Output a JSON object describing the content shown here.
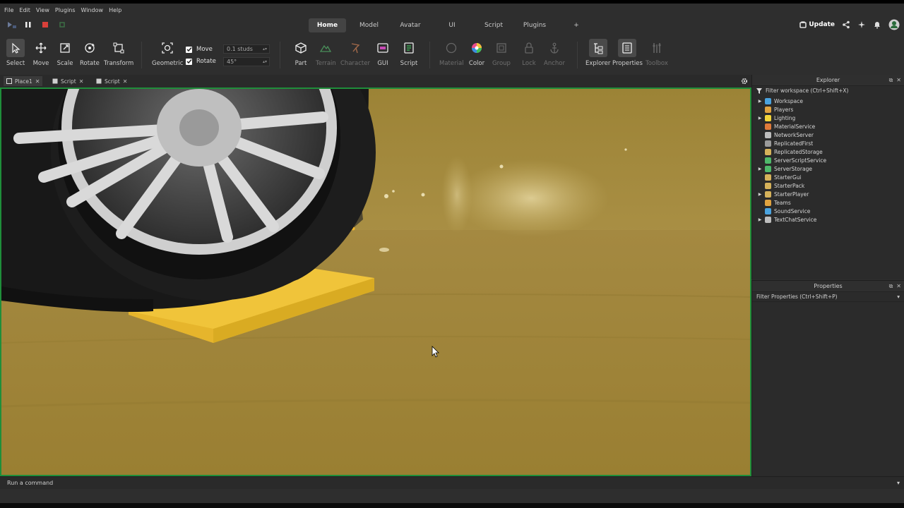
{
  "menu": [
    "File",
    "Edit",
    "View",
    "Plugins",
    "Window",
    "Help"
  ],
  "ribbon_tabs": [
    {
      "label": "Home",
      "active": true
    },
    {
      "label": "Model",
      "active": false
    },
    {
      "label": "Avatar",
      "active": false
    },
    {
      "label": "UI",
      "active": false
    },
    {
      "label": "Script",
      "active": false
    },
    {
      "label": "Plugins",
      "active": false
    },
    {
      "label": "+",
      "active": false
    }
  ],
  "header_right": {
    "update_label": "Update"
  },
  "tools": {
    "select": "Select",
    "move": "Move",
    "scale": "Scale",
    "rotate": "Rotate",
    "transform": "Transform",
    "geometric": "Geometric",
    "part": "Part",
    "terrain": "Terrain",
    "character": "Character",
    "gui": "GUI",
    "script": "Script",
    "material": "Material",
    "color": "Color",
    "group": "Group",
    "lock": "Lock",
    "anchor": "Anchor",
    "explorer": "Explorer",
    "properties": "Properties",
    "toolbox": "Toolbox"
  },
  "snap": {
    "move_label": "Move",
    "move_checked": true,
    "move_value": "0.1 studs",
    "rotate_label": "Rotate",
    "rotate_checked": true,
    "rotate_value": "45°"
  },
  "doc_tabs": [
    {
      "label": "Place1",
      "active": true
    },
    {
      "label": "Script",
      "active": false
    },
    {
      "label": "Script",
      "active": false
    }
  ],
  "explorer": {
    "title": "Explorer",
    "filter_placeholder": "Filter workspace (Ctrl+Shift+X)",
    "items": [
      {
        "label": "Workspace",
        "expandable": true,
        "icon": "globe-icon",
        "color": "#4aa3df"
      },
      {
        "label": "Players",
        "expandable": false,
        "icon": "players-icon",
        "color": "#e0a340"
      },
      {
        "label": "Lighting",
        "expandable": true,
        "icon": "bulb-icon",
        "color": "#f2d43a"
      },
      {
        "label": "MaterialService",
        "expandable": false,
        "icon": "material-icon",
        "color": "#e07a3a"
      },
      {
        "label": "NetworkServer",
        "expandable": false,
        "icon": "network-icon",
        "color": "#bdbdbd"
      },
      {
        "label": "ReplicatedFirst",
        "expandable": false,
        "icon": "replicated-first-icon",
        "color": "#9a9a9a"
      },
      {
        "label": "ReplicatedStorage",
        "expandable": false,
        "icon": "replicated-storage-icon",
        "color": "#d6b25a"
      },
      {
        "label": "ServerScriptService",
        "expandable": false,
        "icon": "script-service-icon",
        "color": "#4fb86a"
      },
      {
        "label": "ServerStorage",
        "expandable": true,
        "icon": "server-storage-icon",
        "color": "#4fb86a"
      },
      {
        "label": "StarterGui",
        "expandable": false,
        "icon": "starter-gui-icon",
        "color": "#d6b25a"
      },
      {
        "label": "StarterPack",
        "expandable": false,
        "icon": "starter-pack-icon",
        "color": "#d6b25a"
      },
      {
        "label": "StarterPlayer",
        "expandable": true,
        "icon": "starter-player-icon",
        "color": "#d6b25a"
      },
      {
        "label": "Teams",
        "expandable": false,
        "icon": "teams-icon",
        "color": "#e0a340"
      },
      {
        "label": "SoundService",
        "expandable": false,
        "icon": "sound-icon",
        "color": "#4aa3df"
      },
      {
        "label": "TextChatService",
        "expandable": true,
        "icon": "chat-icon",
        "color": "#bdbdbd"
      }
    ]
  },
  "properties": {
    "title": "Properties",
    "filter_placeholder": "Filter Properties (Ctrl+Shift+P)"
  },
  "command_bar": {
    "placeholder": "Run a command"
  }
}
